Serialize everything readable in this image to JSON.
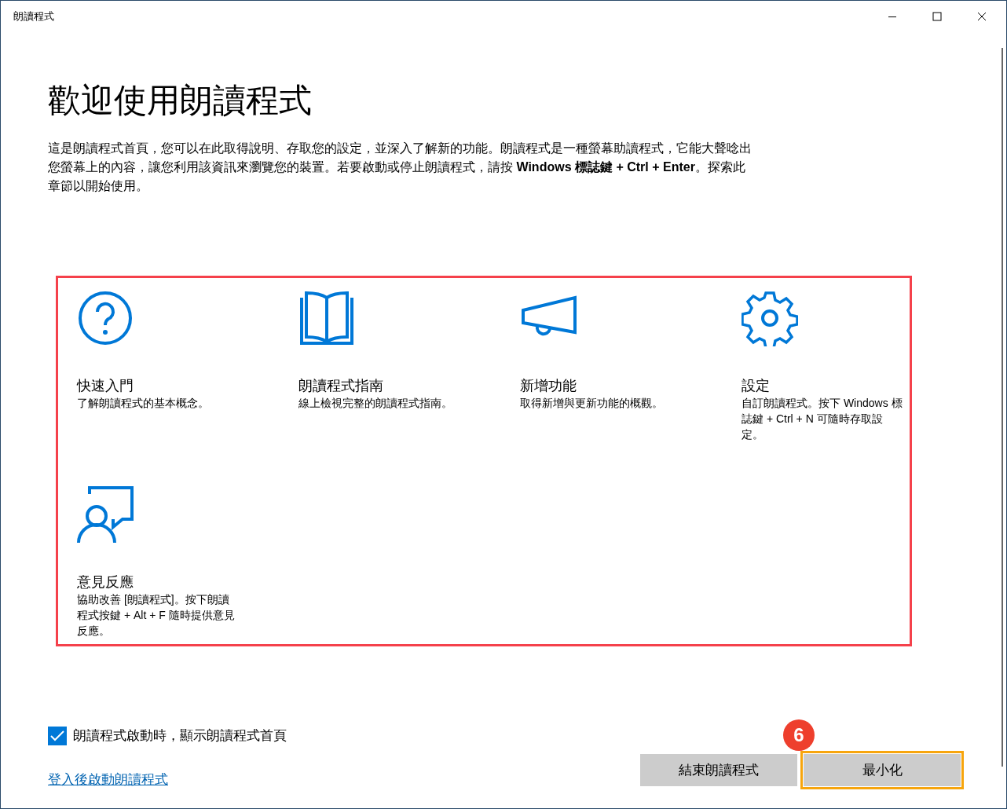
{
  "window": {
    "title": "朗讀程式"
  },
  "heading": "歡迎使用朗讀程式",
  "intro": "這是朗讀程式首頁，您可以在此取得說明、存取您的設定，並深入了解新的功能。朗讀程式是一種螢幕助讀程式，它能大聲唸出您螢幕上的內容，讓您利用該資訊來瀏覽您的裝置。若要啟動或停止朗讀程式，請按 **Windows 標誌鍵 +** **Ctrl + Enter**。探索此章節以開始使用。",
  "features": {
    "highlighted": true,
    "items": [
      {
        "kind": "help",
        "title": "快速入門",
        "description": "了解朗讀程式的基本概念。"
      },
      {
        "kind": "guide",
        "title": "朗讀程式指南",
        "description": "線上檢視完整的朗讀程式指南。"
      },
      {
        "kind": "news",
        "title": "新增功能",
        "description": "取得新增與更新功能的概觀。"
      },
      {
        "kind": "settings",
        "title": "設定",
        "description": "自訂朗讀程式。按下 Windows 標誌鍵 + Ctrl + N 可隨時存取設定。"
      },
      {
        "kind": "feedback",
        "title": "意見反應",
        "description": "協助改善 [朗讀程式]。按下朗讀程式按鍵 + Alt + F 隨時提供意見反應。"
      }
    ]
  },
  "show_home_checkbox": {
    "label": "朗讀程式啟動時，顯示朗讀程式首頁",
    "checked": true
  },
  "startup_link": "登入後啟動朗讀程式",
  "buttons": [
    {
      "label": "結束朗讀程式",
      "highlighted": false
    },
    {
      "label": "最小化",
      "highlighted": true,
      "badge": "6"
    }
  ]
}
